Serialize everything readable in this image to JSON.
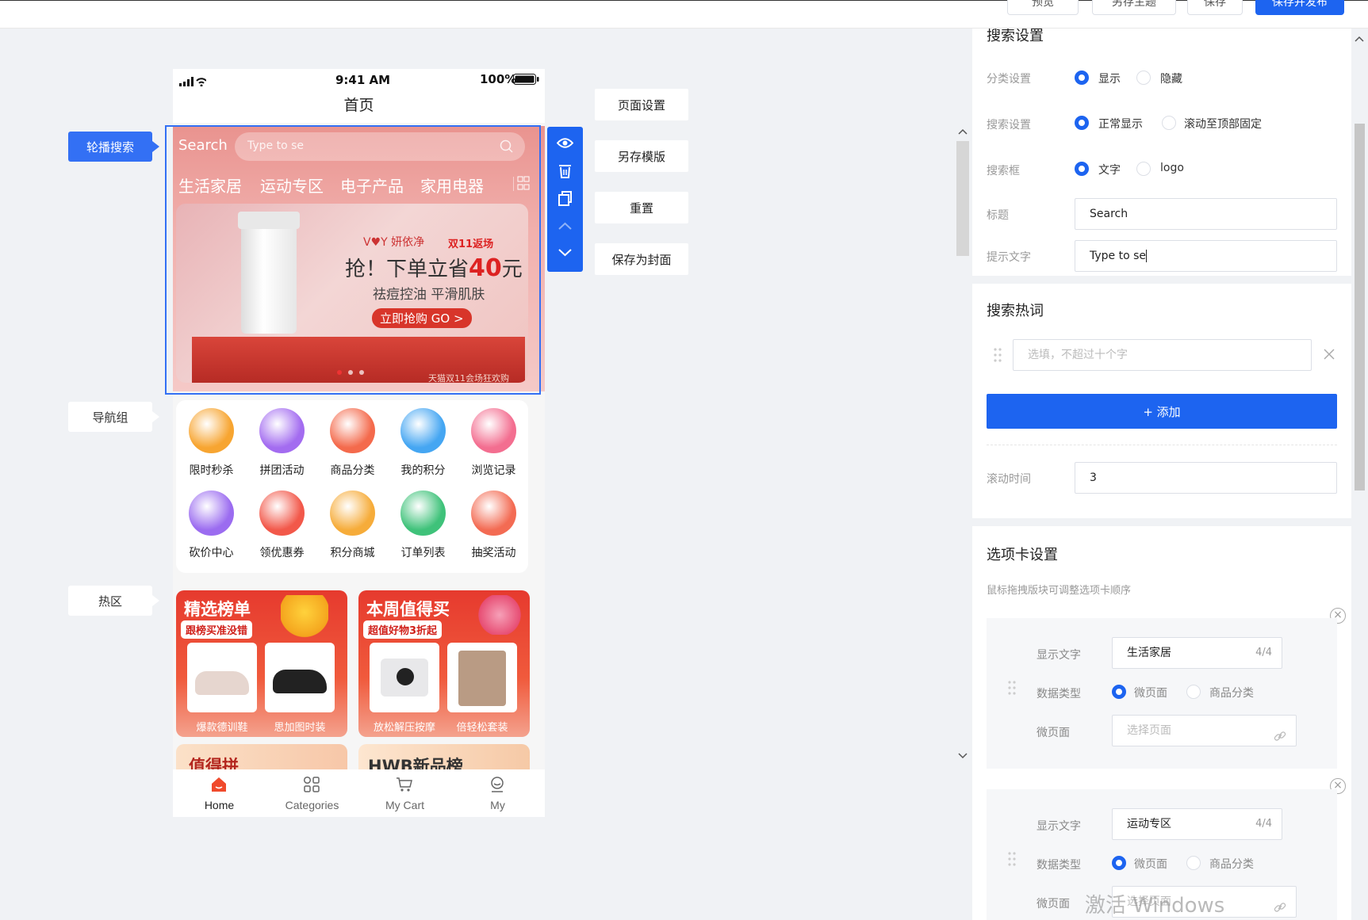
{
  "toolbar": {
    "preview": "预览",
    "save_as_theme": "另存主题",
    "save": "保存",
    "save_publish": "保存并发布"
  },
  "canvas": {
    "side_tags": [
      "轮播搜索",
      "导航组",
      "热区"
    ],
    "actions": [
      "页面设置",
      "另存模版",
      "重置",
      "保存为封面"
    ],
    "tool_icons": [
      "eye-icon",
      "trash-icon",
      "copy-icon",
      "chevron-up-icon",
      "chevron-down-icon"
    ]
  },
  "phone": {
    "time": "9:41 AM",
    "battery": "100%",
    "title": "首页",
    "search": {
      "label": "Search",
      "placeholder": "Type to se"
    },
    "categories": [
      "生活家居",
      "运动专区",
      "电子产品",
      "家用电器"
    ],
    "banner": {
      "brand": "V♥Y 妍依净",
      "tag": "双11返场",
      "headline_prefix": "抢！下单立省",
      "headline_amount": "40",
      "headline_suffix": "元",
      "subline": "祛痘控油 平滑肌肤",
      "cta": "立即抢购 GO >",
      "bottom_text": "天猫双11会场狂欢购"
    },
    "nav_items": [
      {
        "label": "限时秒杀",
        "color": "#f7a531"
      },
      {
        "label": "拼团活动",
        "color": "#a36cf0"
      },
      {
        "label": "商品分类",
        "color": "#f46a4c"
      },
      {
        "label": "我的积分",
        "color": "#45a6f2"
      },
      {
        "label": "浏览记录",
        "color": "#f36e90"
      },
      {
        "label": "砍价中心",
        "color": "#9b6cf0"
      },
      {
        "label": "领优惠券",
        "color": "#f2584a"
      },
      {
        "label": "积分商城",
        "color": "#f6ac3a"
      },
      {
        "label": "订单列表",
        "color": "#3fc27a"
      },
      {
        "label": "抽奖活动",
        "color": "#f36b53"
      }
    ],
    "hot_cards": [
      {
        "title": "精选榜单",
        "badge": "跟榜买准没错",
        "products": [
          "爆款德训鞋",
          "思加图时装"
        ]
      },
      {
        "title": "本周值得买",
        "badge": "超值好物3折起",
        "products": [
          "放松解压按摩",
          "倍轻松套装"
        ]
      }
    ],
    "hot_cards_row2": [
      "值得拼",
      "HWB新品榜"
    ],
    "tabs": [
      "Home",
      "Categories",
      "My Cart",
      "My"
    ]
  },
  "panel": {
    "search_section": {
      "title": "搜索设置",
      "rows": [
        {
          "label": "分类设置",
          "options": [
            "显示",
            "隐藏"
          ],
          "selected": 0
        },
        {
          "label": "搜索设置",
          "options": [
            "正常显示",
            "滚动至顶部固定"
          ],
          "selected": 0
        },
        {
          "label": "搜索框",
          "options": [
            "文字",
            "logo"
          ],
          "selected": 0
        }
      ],
      "title_label": "标题",
      "title_value": "Search",
      "hint_label": "提示文字",
      "hint_value": "Type to se"
    },
    "hot_words": {
      "title": "搜索热词",
      "input_placeholder": "选填，不超过十个字",
      "add_button": "+ 添加",
      "interval_label": "滚动时间",
      "interval_value": "3"
    },
    "tab_settings": {
      "title": "选项卡设置",
      "hint": "鼠标拖拽版块可调整选项卡顺序",
      "cards": [
        {
          "text_label": "显示文字",
          "text_value": "生活家居",
          "count": "4/4",
          "type_label": "数据类型",
          "types": [
            "微页面",
            "商品分类"
          ],
          "page_label": "微页面",
          "page_placeholder": "选择页面"
        },
        {
          "text_label": "显示文字",
          "text_value": "运动专区",
          "count": "4/4",
          "type_label": "数据类型",
          "types": [
            "微页面",
            "商品分类"
          ],
          "page_label": "微页面",
          "page_placeholder": "选择页面"
        }
      ]
    }
  },
  "watermark": "激活 Windows"
}
